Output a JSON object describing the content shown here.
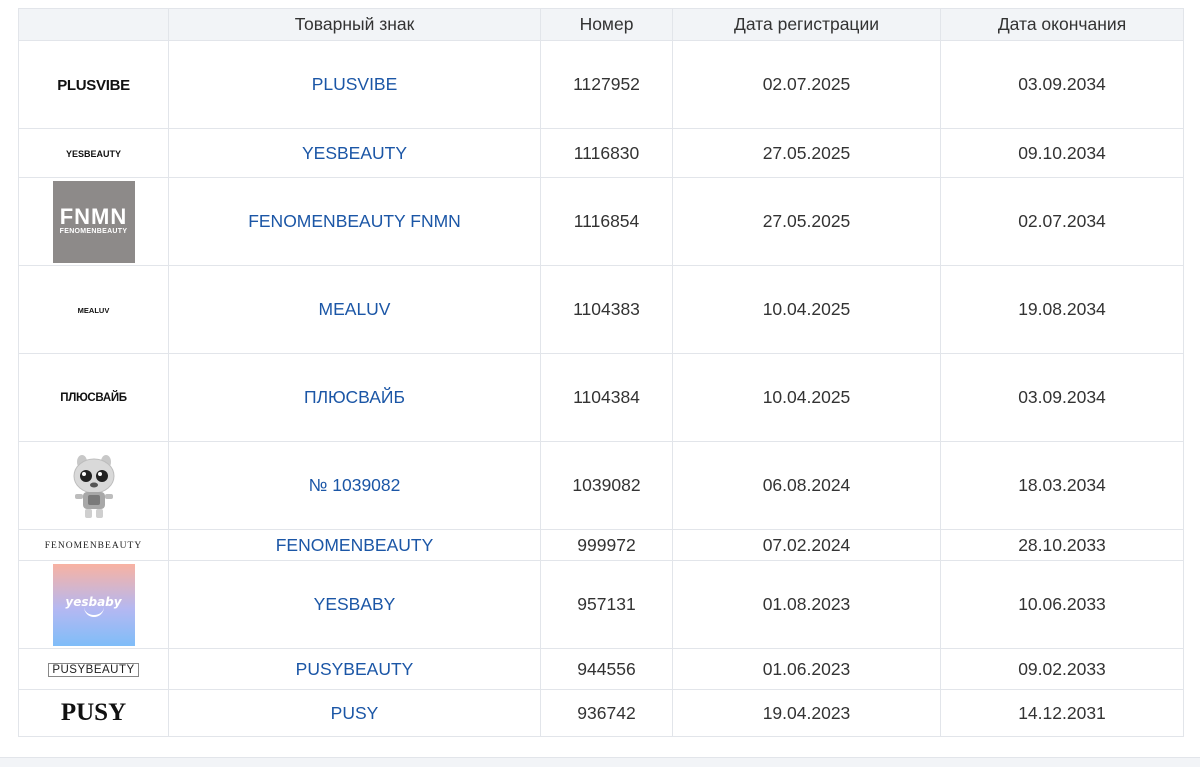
{
  "table": {
    "headers": {
      "logo": "",
      "mark": "Товарный знак",
      "number": "Номер",
      "reg_date": "Дата регистрации",
      "exp_date": "Дата окончания"
    },
    "rows": [
      {
        "logo_text": "PLUSVIBE",
        "name": "PLUSVIBE",
        "number": "1127952",
        "reg_date": "02.07.2025",
        "exp_date": "03.09.2034"
      },
      {
        "logo_text": "YESBEAUTY",
        "name": "YESBEAUTY",
        "number": "1116830",
        "reg_date": "27.05.2025",
        "exp_date": "09.10.2034"
      },
      {
        "logo_text": "FNMN",
        "logo_subtext": "FENOMENBEAUTY",
        "name": "FENOMENBEAUTY FNMN",
        "number": "1116854",
        "reg_date": "27.05.2025",
        "exp_date": "02.07.2034"
      },
      {
        "logo_text": "MEALUV",
        "name": "MEALUV",
        "number": "1104383",
        "reg_date": "10.04.2025",
        "exp_date": "19.08.2034"
      },
      {
        "logo_text": "ПЛЮСВАЙБ",
        "name": "ПЛЮСВАЙБ",
        "number": "1104384",
        "reg_date": "10.04.2025",
        "exp_date": "03.09.2034"
      },
      {
        "logo_text": "",
        "name": "№ 1039082",
        "number": "1039082",
        "reg_date": "06.08.2024",
        "exp_date": "18.03.2034"
      },
      {
        "logo_text": "FENOMENBEAUTY",
        "name": "FENOMENBEAUTY",
        "number": "999972",
        "reg_date": "07.02.2024",
        "exp_date": "28.10.2033"
      },
      {
        "logo_text": "yesbaby",
        "name": "YESBABY",
        "number": "957131",
        "reg_date": "01.08.2023",
        "exp_date": "10.06.2033"
      },
      {
        "logo_text": "PUSYBEAUTY",
        "name": "PUSYBEAUTY",
        "number": "944556",
        "reg_date": "01.06.2023",
        "exp_date": "09.02.2033"
      },
      {
        "logo_text": "PUSY",
        "name": "PUSY",
        "number": "936742",
        "reg_date": "19.04.2023",
        "exp_date": "14.12.2031"
      }
    ]
  },
  "colors": {
    "link": "#1b56a6",
    "header_bg": "#f2f4f7",
    "border": "#e2e5ea"
  }
}
